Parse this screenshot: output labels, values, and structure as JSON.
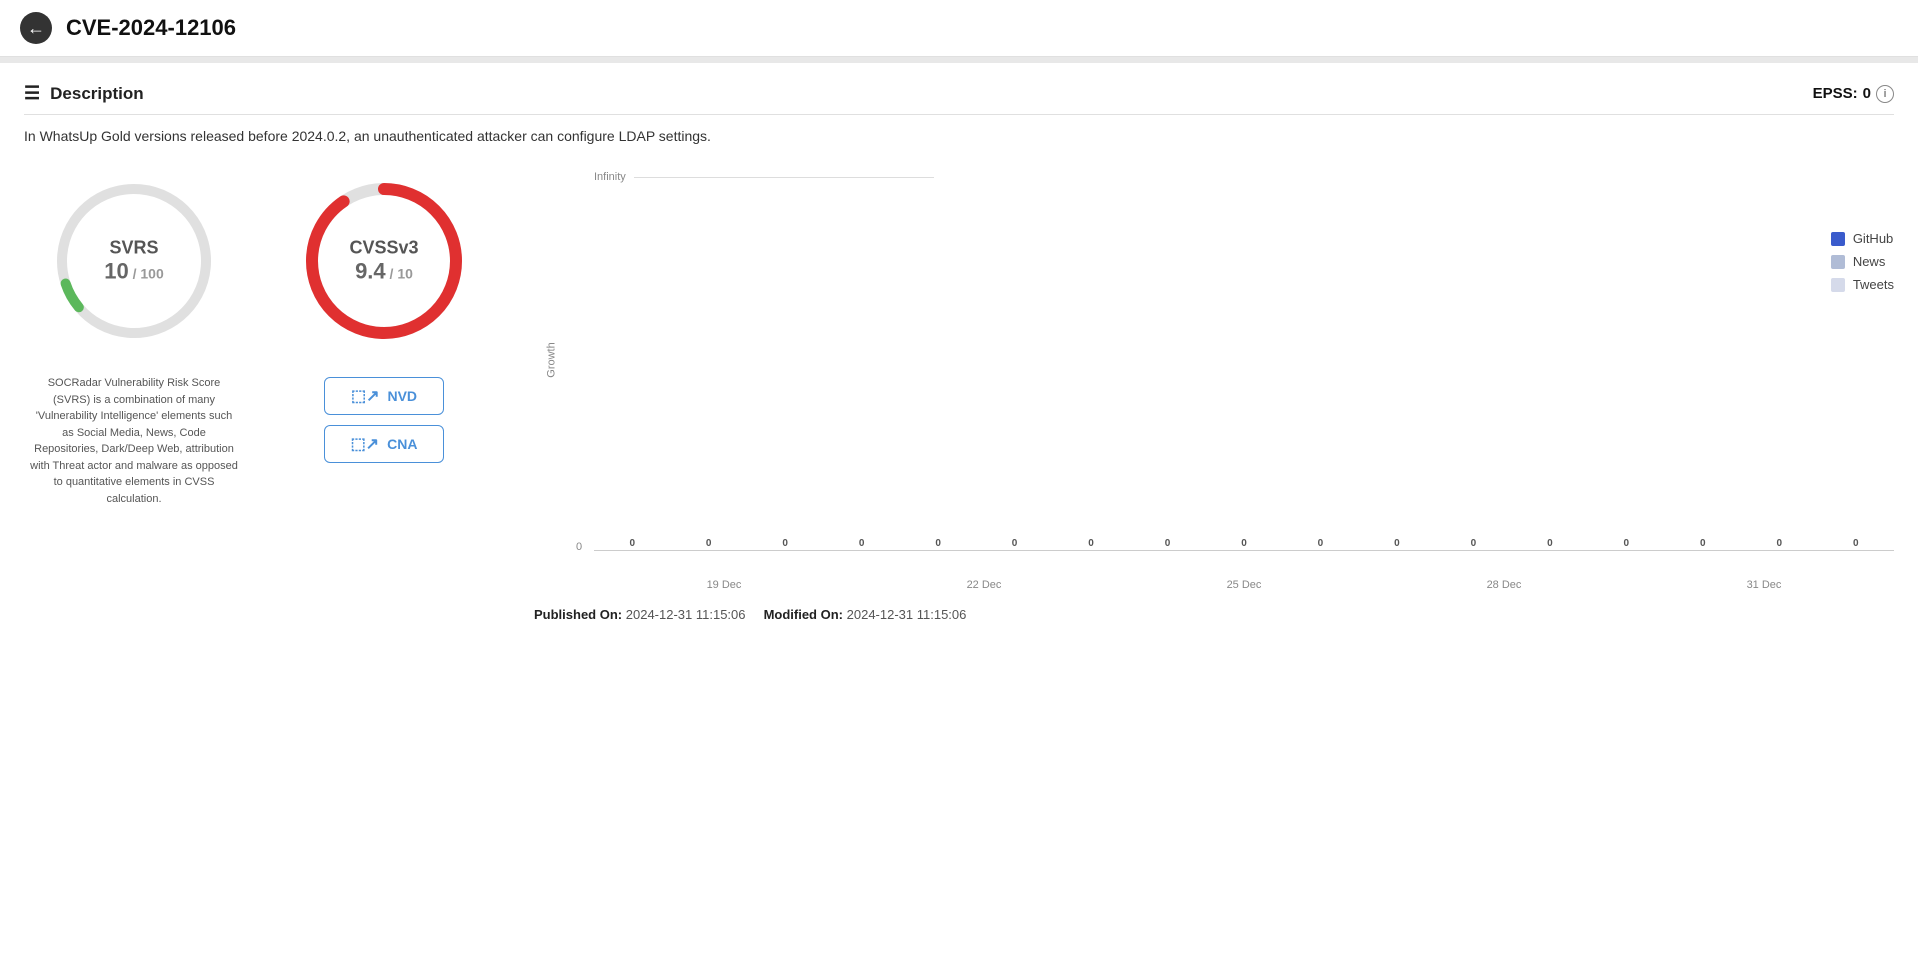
{
  "header": {
    "back_label": "←",
    "title": "CVE-2024-12106"
  },
  "section": {
    "title": "Description",
    "epss_label": "EPSS:",
    "epss_value": "0"
  },
  "description": {
    "text": "In WhatsUp Gold versions released before 2024.0.2, an unauthenticated attacker can configure LDAP settings."
  },
  "svrs": {
    "title": "SVRS",
    "value": "10",
    "max": "100",
    "description": "SOCRadar Vulnerability Risk Score (SVRS) is a combination of many 'Vulnerability Intelligence' elements such as Social Media, News, Code Repositories, Dark/Deep Web, attribution with Threat actor and malware as opposed to quantitative elements in CVSS calculation."
  },
  "cvss": {
    "title": "CVSSv3",
    "value": "9.4",
    "max": "10",
    "nvd_label": "NVD",
    "cna_label": "CNA"
  },
  "chart": {
    "y_labels": [
      "Infinity",
      ""
    ],
    "x_labels": [
      "19 Dec",
      "22 Dec",
      "25 Dec",
      "28 Dec",
      "31 Dec"
    ],
    "zero_markers": [
      "0",
      "0",
      "0",
      "0",
      "0",
      "0",
      "0",
      "0",
      "0",
      "0",
      "0",
      "0",
      "0",
      "0",
      "0",
      "0",
      "0"
    ],
    "left_zero": "0",
    "growth_label": "Growth",
    "infinity_label": "Infinity"
  },
  "legend": {
    "items": [
      {
        "label": "GitHub",
        "color_class": "legend-github"
      },
      {
        "label": "News",
        "color_class": "legend-news"
      },
      {
        "label": "Tweets",
        "color_class": "legend-tweets"
      }
    ]
  },
  "footer": {
    "published_label": "Published On:",
    "published_value": "2024-12-31 11:15:06",
    "modified_label": "Modified On:",
    "modified_value": "2024-12-31 11:15:06"
  }
}
